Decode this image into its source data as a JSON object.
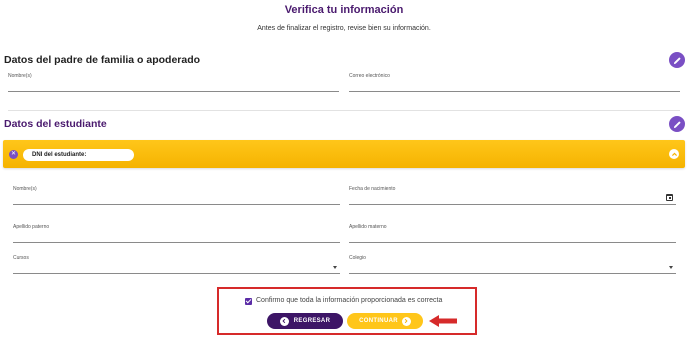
{
  "header": {
    "title": "Verifica tu información",
    "subtitle": "Antes de finalizar el registro, revise bien su información."
  },
  "parent_section": {
    "title": "Datos del padre de familia o apoderado",
    "fields": {
      "name_label": "Nombre(s)",
      "name_value": "",
      "email_label": "Correo electrónico",
      "email_value": ""
    }
  },
  "student_section": {
    "title": "Datos del estudiante",
    "dni_label": "DNI del estudiante:",
    "fields": {
      "name_label": "Nombre(s)",
      "birthdate_label": "Fecha de nacimiento",
      "paternal_label": "Apellido paterno",
      "maternal_label": "Apellido materno",
      "courses_label": "Cursos",
      "school_label": "Colegio"
    }
  },
  "confirmation": {
    "checked": true,
    "text": "Confirmo que toda la información proporcionada es correcta",
    "back_label": "REGRESAR",
    "continue_label": "CONTINUAR"
  },
  "colors": {
    "title_purple": "#4a1a6e",
    "accent_purple": "#7a4fc4",
    "yellow": "#ffc61a",
    "dark_purple_button": "#3d1566",
    "highlight_red": "#d62a2a"
  },
  "icons": {
    "edit": "pencil-icon",
    "remove": "close-icon",
    "collapse": "chevron-up-icon",
    "calendar": "calendar-icon",
    "dropdown": "caret-down-icon",
    "back": "arrow-left-icon",
    "next": "arrow-right-icon"
  }
}
